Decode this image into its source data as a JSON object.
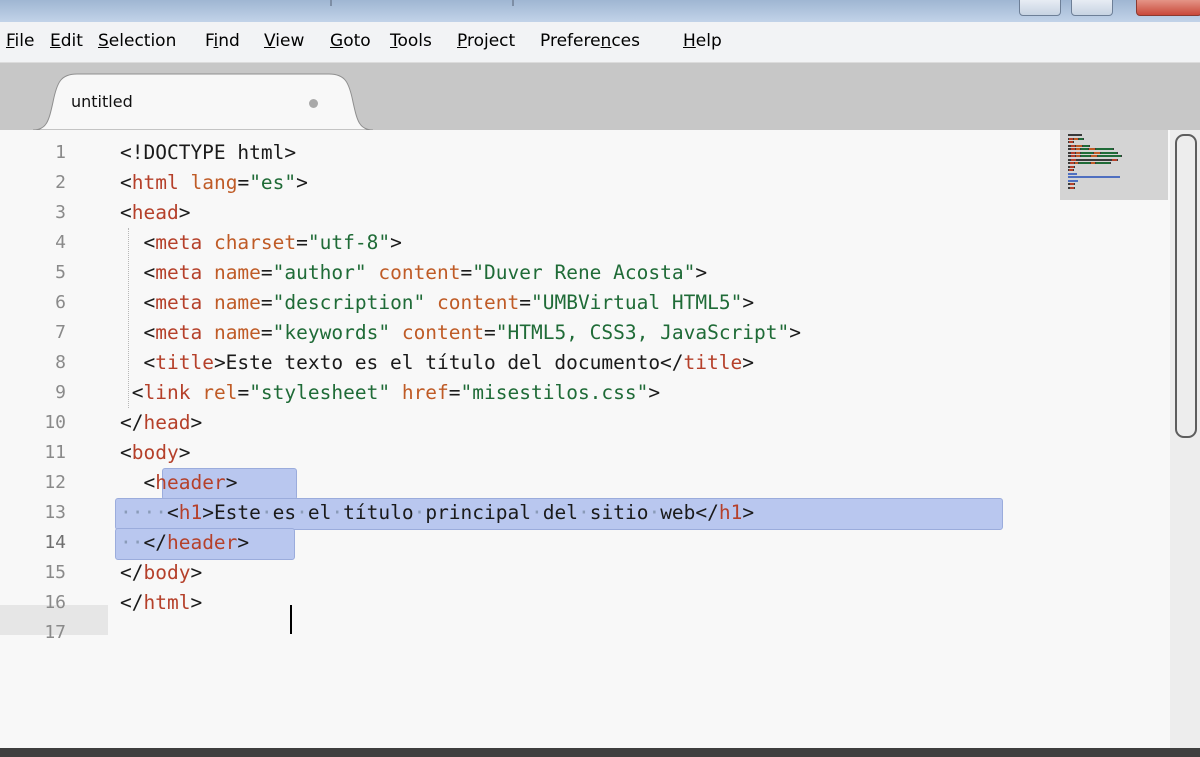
{
  "menu": [
    {
      "pre": "",
      "u": "F",
      "post": "ile"
    },
    {
      "pre": "",
      "u": "E",
      "post": "dit"
    },
    {
      "pre": "",
      "u": "S",
      "post": "election"
    },
    {
      "pre": "F",
      "u": "i",
      "post": "nd"
    },
    {
      "pre": "",
      "u": "V",
      "post": "iew"
    },
    {
      "pre": "",
      "u": "G",
      "post": "oto"
    },
    {
      "pre": "",
      "u": "T",
      "post": "ools"
    },
    {
      "pre": "",
      "u": "P",
      "post": "roject"
    },
    {
      "pre": "Prefere",
      "u": "n",
      "post": "ces"
    },
    {
      "pre": "",
      "u": "H",
      "post": "elp"
    }
  ],
  "tab": {
    "label": "untitled",
    "dirty_indicator": "•"
  },
  "editor": {
    "active_line": 14,
    "colors": {
      "tag": "#b5402a",
      "attribute": "#bf5b26",
      "string": "#1f6b37",
      "selection": "#b9c7ef"
    },
    "lines": [
      [
        {
          "c": "p",
          "t": "<!DOCTYPE html>"
        }
      ],
      [
        {
          "c": "p",
          "t": "<"
        },
        {
          "c": "t",
          "t": "html"
        },
        {
          "c": "p",
          "t": " "
        },
        {
          "c": "a",
          "t": "lang"
        },
        {
          "c": "p",
          "t": "="
        },
        {
          "c": "s",
          "t": "\"es\""
        },
        {
          "c": "p",
          "t": ">"
        }
      ],
      [
        {
          "c": "p",
          "t": "<"
        },
        {
          "c": "t",
          "t": "head"
        },
        {
          "c": "p",
          "t": ">"
        }
      ],
      [
        {
          "c": "p",
          "t": "  <"
        },
        {
          "c": "t",
          "t": "meta"
        },
        {
          "c": "p",
          "t": " "
        },
        {
          "c": "a",
          "t": "charset"
        },
        {
          "c": "p",
          "t": "="
        },
        {
          "c": "s",
          "t": "\"utf-8\""
        },
        {
          "c": "p",
          "t": ">"
        }
      ],
      [
        {
          "c": "p",
          "t": "  <"
        },
        {
          "c": "t",
          "t": "meta"
        },
        {
          "c": "p",
          "t": " "
        },
        {
          "c": "a",
          "t": "name"
        },
        {
          "c": "p",
          "t": "="
        },
        {
          "c": "s",
          "t": "\"author\""
        },
        {
          "c": "p",
          "t": " "
        },
        {
          "c": "a",
          "t": "content"
        },
        {
          "c": "p",
          "t": "="
        },
        {
          "c": "s",
          "t": "\"Duver Rene Acosta\""
        },
        {
          "c": "p",
          "t": ">"
        }
      ],
      [
        {
          "c": "p",
          "t": "  <"
        },
        {
          "c": "t",
          "t": "meta"
        },
        {
          "c": "p",
          "t": " "
        },
        {
          "c": "a",
          "t": "name"
        },
        {
          "c": "p",
          "t": "="
        },
        {
          "c": "s",
          "t": "\"description\""
        },
        {
          "c": "p",
          "t": " "
        },
        {
          "c": "a",
          "t": "content"
        },
        {
          "c": "p",
          "t": "="
        },
        {
          "c": "s",
          "t": "\"UMBVirtual HTML5\""
        },
        {
          "c": "p",
          "t": ">"
        }
      ],
      [
        {
          "c": "p",
          "t": "  <"
        },
        {
          "c": "t",
          "t": "meta"
        },
        {
          "c": "p",
          "t": " "
        },
        {
          "c": "a",
          "t": "name"
        },
        {
          "c": "p",
          "t": "="
        },
        {
          "c": "s",
          "t": "\"keywords\""
        },
        {
          "c": "p",
          "t": " "
        },
        {
          "c": "a",
          "t": "content"
        },
        {
          "c": "p",
          "t": "="
        },
        {
          "c": "s",
          "t": "\"HTML5, CSS3, JavaScript\""
        },
        {
          "c": "p",
          "t": ">"
        }
      ],
      [
        {
          "c": "p",
          "t": "  <"
        },
        {
          "c": "t",
          "t": "title"
        },
        {
          "c": "p",
          "t": ">Este texto es el título del documento</"
        },
        {
          "c": "t",
          "t": "title"
        },
        {
          "c": "p",
          "t": ">"
        }
      ],
      [
        {
          "c": "p",
          "t": " <"
        },
        {
          "c": "t",
          "t": "link"
        },
        {
          "c": "p",
          "t": " "
        },
        {
          "c": "a",
          "t": "rel"
        },
        {
          "c": "p",
          "t": "="
        },
        {
          "c": "s",
          "t": "\"stylesheet\""
        },
        {
          "c": "p",
          "t": " "
        },
        {
          "c": "a",
          "t": "href"
        },
        {
          "c": "p",
          "t": "="
        },
        {
          "c": "s",
          "t": "\"misestilos.css\""
        },
        {
          "c": "p",
          "t": ">"
        }
      ],
      [
        {
          "c": "p",
          "t": "</"
        },
        {
          "c": "t",
          "t": "head"
        },
        {
          "c": "p",
          "t": ">"
        }
      ],
      [
        {
          "c": "p",
          "t": "<"
        },
        {
          "c": "t",
          "t": "body"
        },
        {
          "c": "p",
          "t": ">"
        }
      ],
      [
        {
          "c": "p",
          "t": "  <"
        },
        {
          "c": "t",
          "t": "header"
        },
        {
          "c": "p",
          "t": ">"
        }
      ],
      [
        {
          "c": "dot",
          "t": "····"
        },
        {
          "c": "p",
          "t": "<"
        },
        {
          "c": "t",
          "t": "h1"
        },
        {
          "c": "p",
          "t": ">Este"
        },
        {
          "c": "dot",
          "t": "·"
        },
        {
          "c": "p",
          "t": "es"
        },
        {
          "c": "dot",
          "t": "·"
        },
        {
          "c": "p",
          "t": "el"
        },
        {
          "c": "dot",
          "t": "·"
        },
        {
          "c": "p",
          "t": "título"
        },
        {
          "c": "dot",
          "t": "·"
        },
        {
          "c": "p",
          "t": "principal"
        },
        {
          "c": "dot",
          "t": "·"
        },
        {
          "c": "p",
          "t": "del"
        },
        {
          "c": "dot",
          "t": "·"
        },
        {
          "c": "p",
          "t": "sitio"
        },
        {
          "c": "dot",
          "t": "·"
        },
        {
          "c": "p",
          "t": "web</"
        },
        {
          "c": "t",
          "t": "h1"
        },
        {
          "c": "p",
          "t": ">"
        }
      ],
      [
        {
          "c": "dot",
          "t": "··"
        },
        {
          "c": "p",
          "t": "</"
        },
        {
          "c": "t",
          "t": "header"
        },
        {
          "c": "p",
          "t": ">"
        }
      ],
      [
        {
          "c": "p",
          "t": "</"
        },
        {
          "c": "t",
          "t": "body"
        },
        {
          "c": "p",
          "t": ">"
        }
      ],
      [
        {
          "c": "p",
          "t": "</"
        },
        {
          "c": "t",
          "t": "html"
        },
        {
          "c": "p",
          "t": ">"
        }
      ],
      []
    ]
  }
}
